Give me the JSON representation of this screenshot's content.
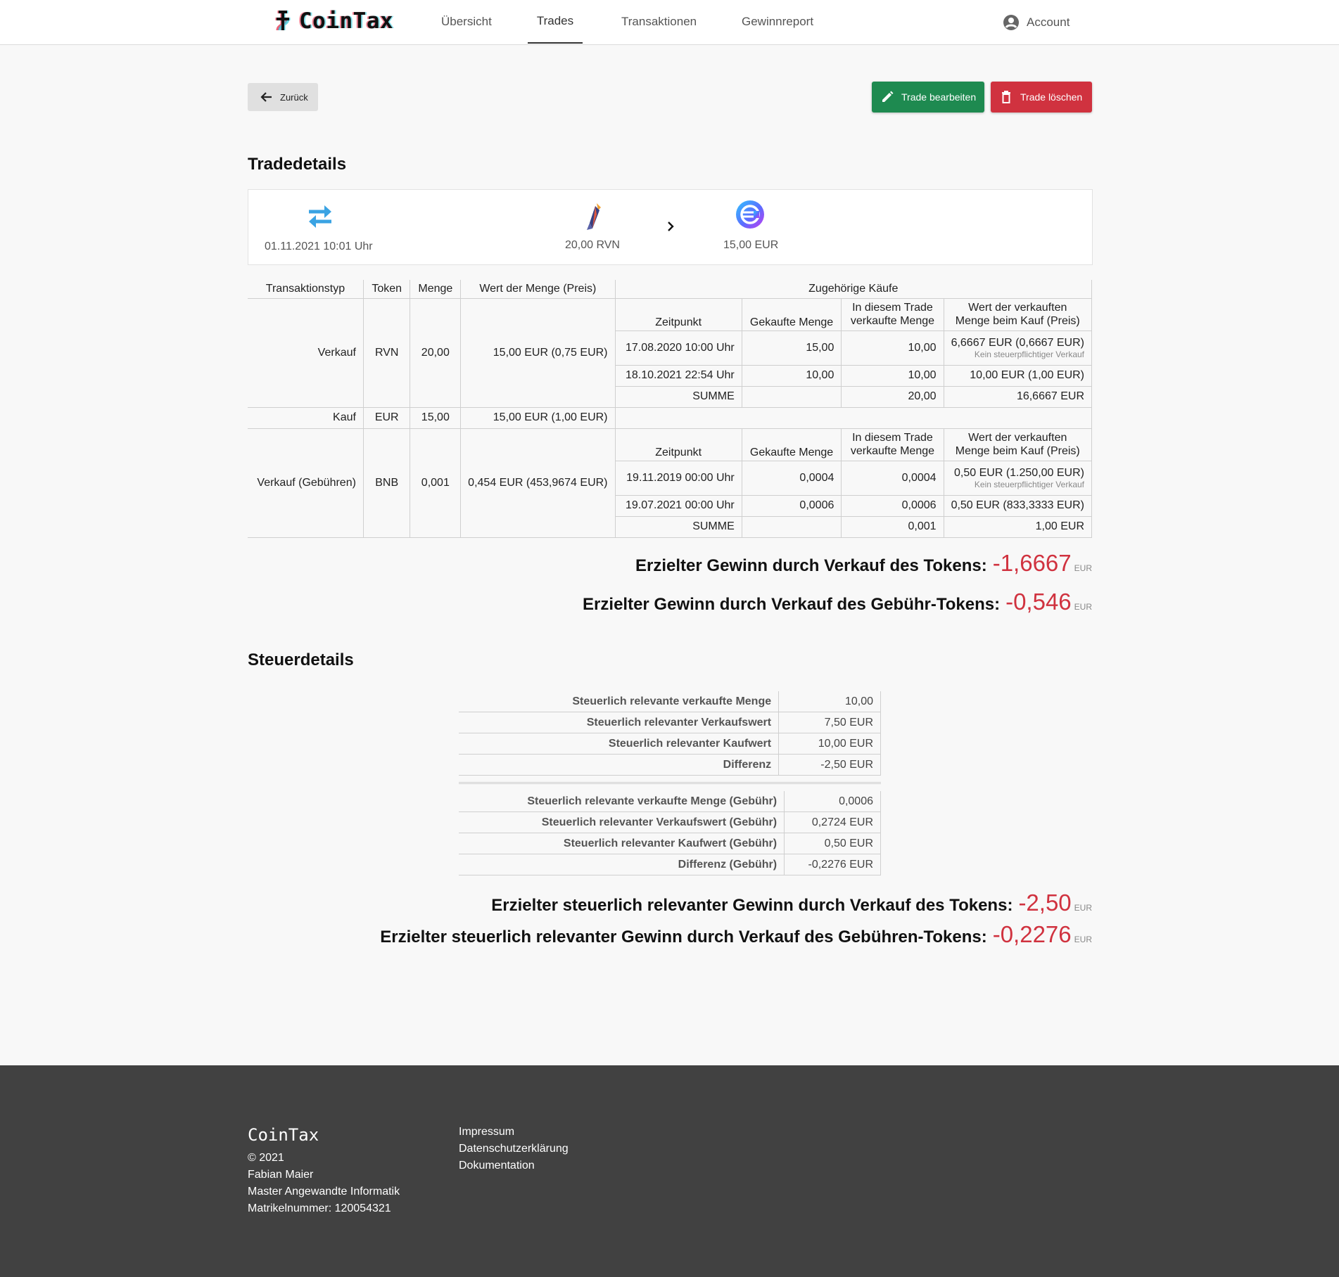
{
  "header": {
    "brand": "CoinTax",
    "nav": [
      "Übersicht",
      "Trades",
      "Transaktionen",
      "Gewinnreport"
    ],
    "active_nav": "Trades",
    "account": "Account"
  },
  "actions": {
    "back": "Zurück",
    "edit": "Trade bearbeiten",
    "delete": "Trade löschen"
  },
  "tradedetails": {
    "title": "Tradedetails",
    "timestamp": "01.11.2021 10:01 Uhr",
    "from_amount": "20,00 RVN",
    "to_amount": "15,00 EUR"
  },
  "table": {
    "headers": {
      "typ": "Transaktionstyp",
      "token": "Token",
      "menge": "Menge",
      "wert": "Wert der Menge (Preis)",
      "zugehoerig": "Zugehörige Käufe"
    },
    "sub_headers": {
      "zeitpunkt": "Zeitpunkt",
      "gekauft": "Gekaufte Menge",
      "verkauft_1": "In diesem Trade",
      "verkauft_2": "verkaufte Menge",
      "wert_1": "Wert der verkauften",
      "wert_2": "Menge beim Kauf (Preis)"
    },
    "rows": [
      {
        "typ": "Verkauf",
        "token": "RVN",
        "menge": "20,00",
        "wert": "15,00 EUR (0,75 EUR)",
        "purchases": [
          {
            "zeit": "17.08.2020 10:00 Uhr",
            "gekauft": "15,00",
            "verkauft": "10,00",
            "wert": "6,6667 EUR (0,6667 EUR)",
            "note": "Kein steuerpflichtiger Verkauf"
          },
          {
            "zeit": "18.10.2021 22:54 Uhr",
            "gekauft": "10,00",
            "verkauft": "10,00",
            "wert": "10,00 EUR (1,00 EUR)",
            "note": ""
          }
        ],
        "sum_label": "SUMME",
        "sum_verkauft": "20,00",
        "sum_wert": "16,6667 EUR"
      },
      {
        "typ": "Kauf",
        "token": "EUR",
        "menge": "15,00",
        "wert": "15,00 EUR (1,00 EUR)"
      },
      {
        "typ": "Verkauf (Gebühren)",
        "token": "BNB",
        "menge": "0,001",
        "wert": "0,454 EUR (453,9674 EUR)",
        "purchases": [
          {
            "zeit": "19.11.2019 00:00 Uhr",
            "gekauft": "0,0004",
            "verkauft": "0,0004",
            "wert": "0,50 EUR (1.250,00 EUR)",
            "note": "Kein steuerpflichtiger Verkauf"
          },
          {
            "zeit": "19.07.2021 00:00 Uhr",
            "gekauft": "0,0006",
            "verkauft": "0,0006",
            "wert": "0,50 EUR (833,3333 EUR)",
            "note": ""
          }
        ],
        "sum_label": "SUMME",
        "sum_verkauft": "0,001",
        "sum_wert": "1,00 EUR"
      }
    ]
  },
  "gains": {
    "token_label": "Erzielter Gewinn durch Verkauf des Tokens:",
    "token_value": "-1,6667",
    "fee_label": "Erzielter Gewinn durch Verkauf des Gebühr-Tokens:",
    "fee_value": "-0,546",
    "unit": "EUR"
  },
  "steuerdetails": {
    "title": "Steuerdetails",
    "token_rows": [
      {
        "label": "Steuerlich relevante verkaufte Menge",
        "value": "10,00"
      },
      {
        "label": "Steuerlich relevanter Verkaufswert",
        "value": "7,50 EUR"
      },
      {
        "label": "Steuerlich relevanter Kaufwert",
        "value": "10,00 EUR"
      },
      {
        "label": "Differenz",
        "value": "-2,50 EUR"
      }
    ],
    "fee_rows": [
      {
        "label": "Steuerlich relevante verkaufte Menge (Gebühr)",
        "value": "0,0006"
      },
      {
        "label": "Steuerlich relevanter Verkaufswert (Gebühr)",
        "value": "0,2724 EUR"
      },
      {
        "label": "Steuerlich relevanter Kaufwert (Gebühr)",
        "value": "0,50 EUR"
      },
      {
        "label": "Differenz (Gebühr)",
        "value": "-0,2276 EUR"
      }
    ],
    "gain_token_label": "Erzielter steuerlich relevanter Gewinn durch Verkauf des Tokens:",
    "gain_token_value": "-2,50",
    "gain_fee_label": "Erzielter steuerlich relevanter Gewinn durch Verkauf des Gebühren-Tokens:",
    "gain_fee_value": "-0,2276",
    "unit": "EUR"
  },
  "footer": {
    "brand": "CoinTax",
    "copyright": "© 2021",
    "author": "Fabian Maier",
    "program": "Master Angewandte Informatik",
    "matrikel": "Matrikelnummer: 120054321",
    "links": [
      "Impressum",
      "Datenschutzerklärung",
      "Dokumentation"
    ]
  },
  "colors": {
    "edit_button": "#1e8a50",
    "delete_button": "#d0323f",
    "loss_value": "#d0323f",
    "swap_icon": "#3aa3e3",
    "footer_bg": "#414141"
  }
}
